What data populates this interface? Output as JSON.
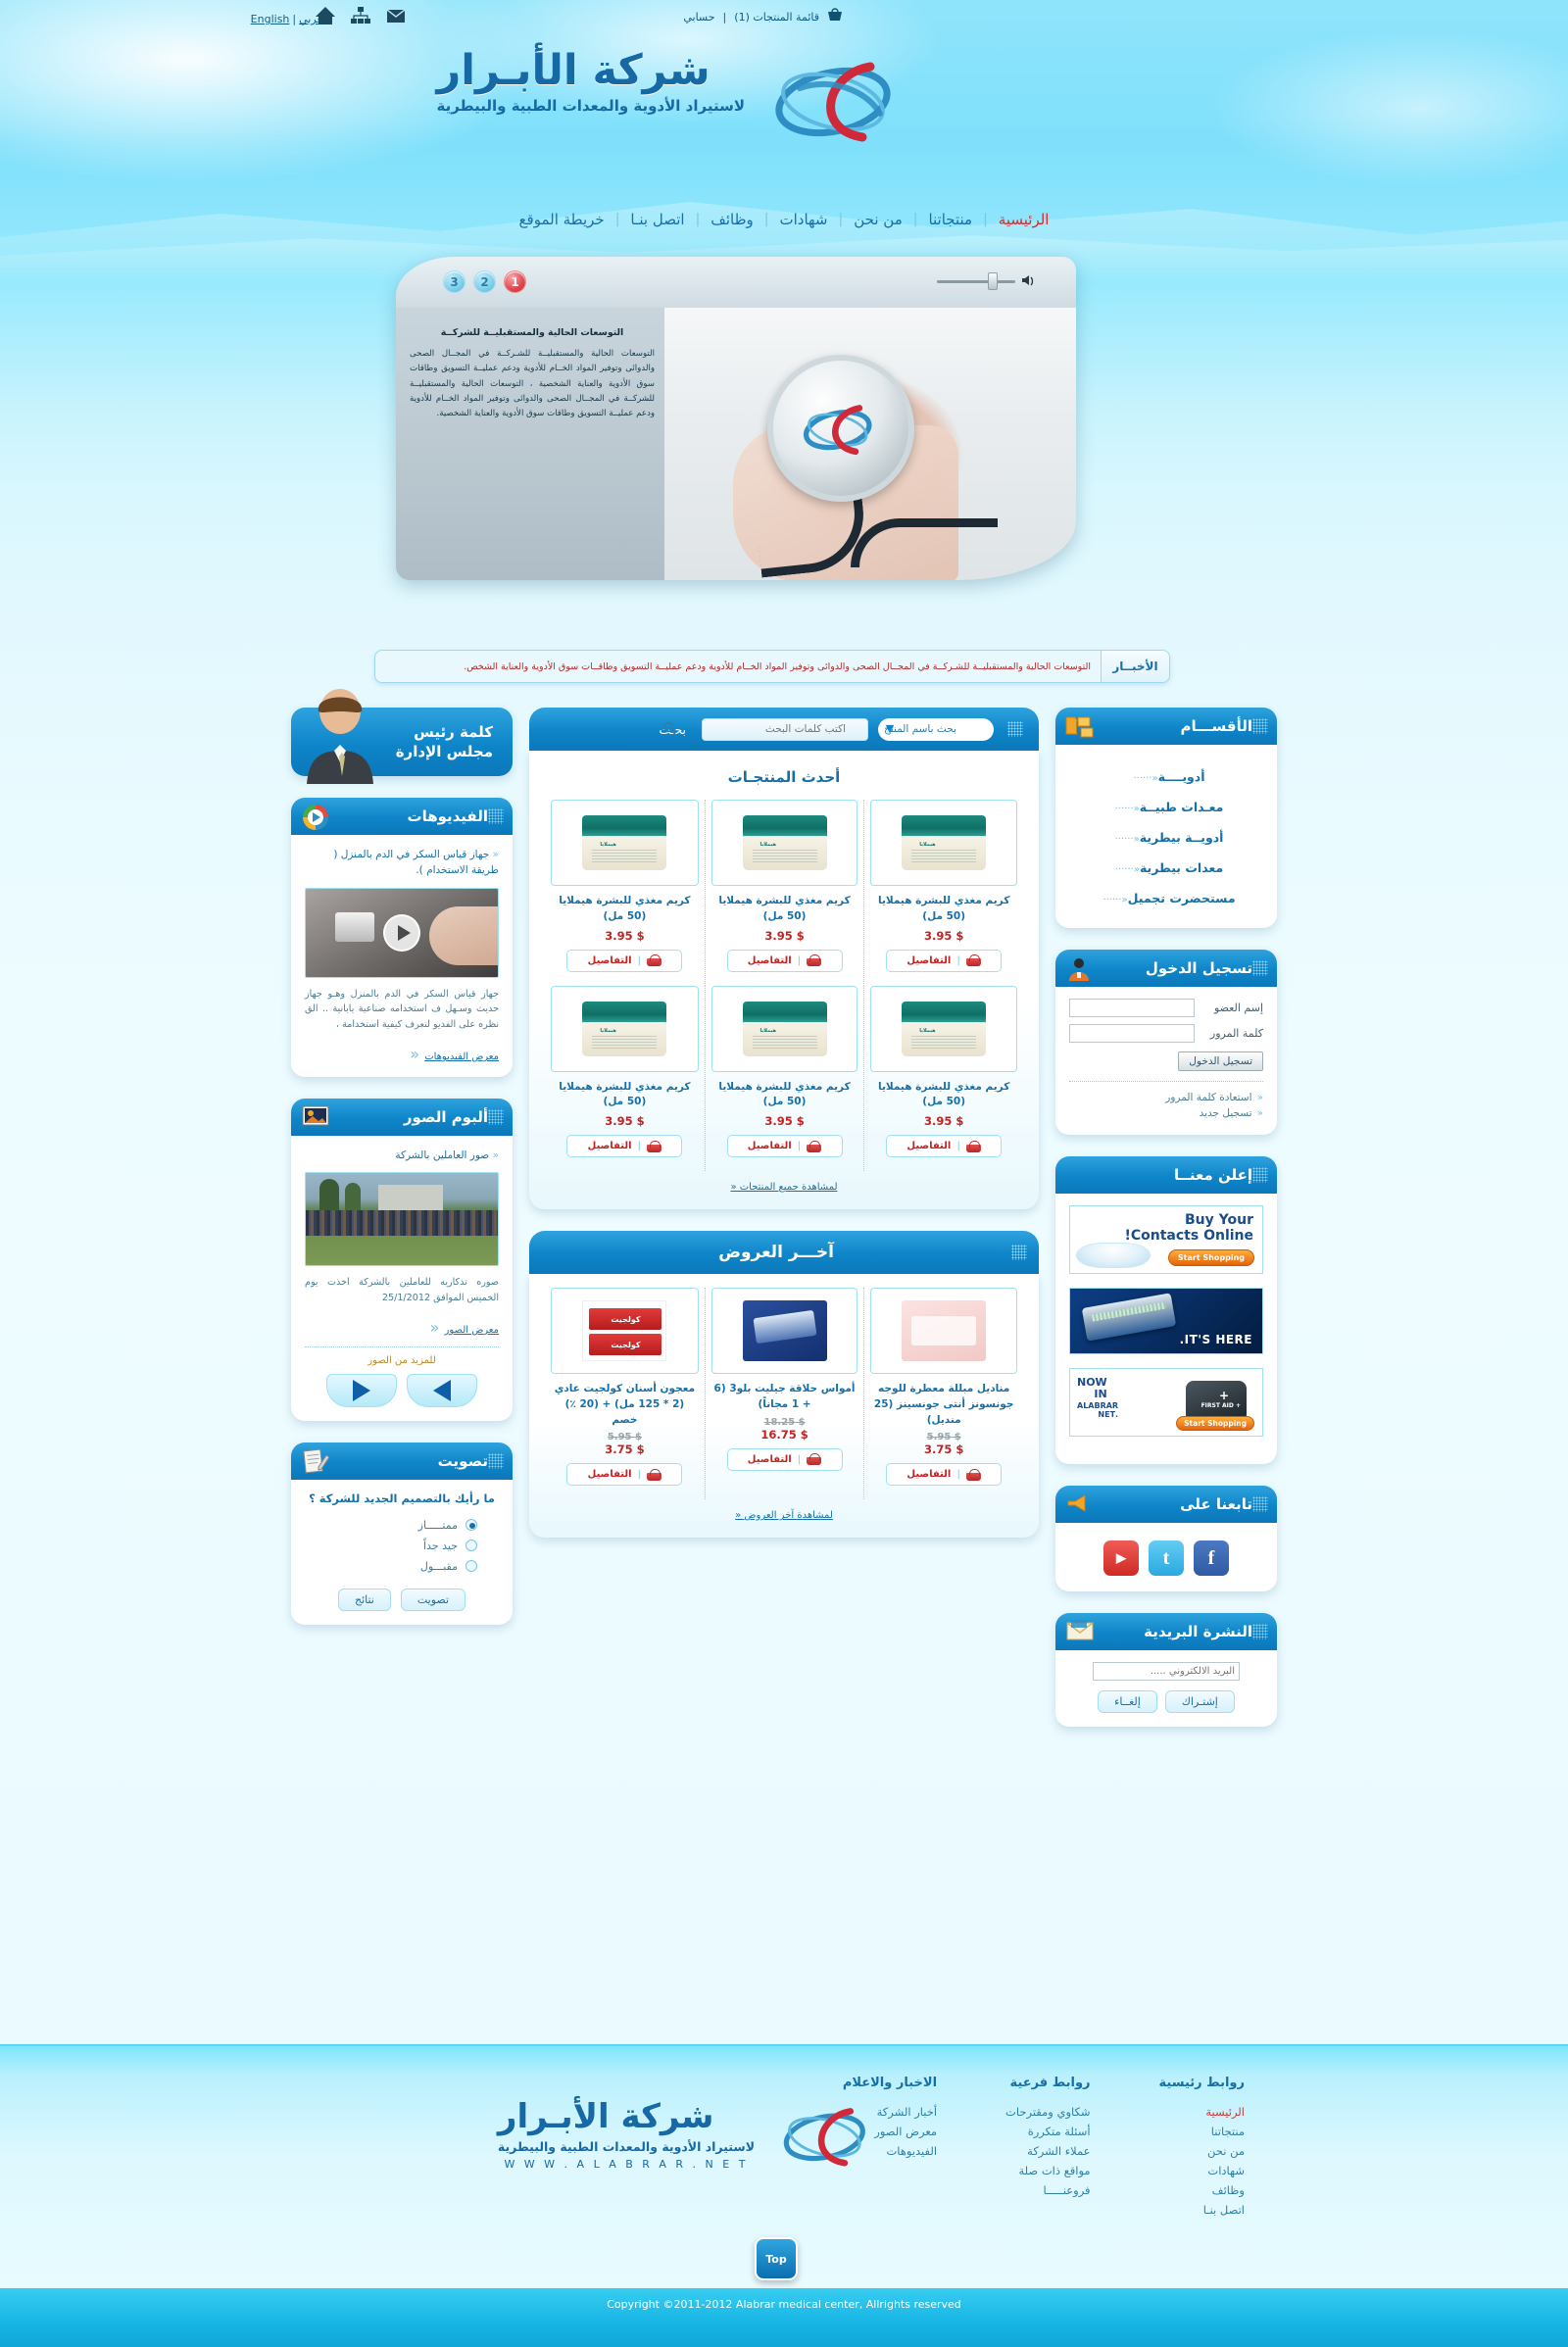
{
  "topbar": {
    "lang_ar": "عربي",
    "lang_sep": "|",
    "lang_en": "English",
    "cart_label": "قائمة المنتجات (1)",
    "sep": "|",
    "account_label": "حسابي",
    "icons": [
      "cart-icon",
      "mail-icon",
      "sitemap-icon",
      "home-icon"
    ]
  },
  "header": {
    "brand_title": "شركة الأبـرار",
    "brand_sub": "لاستيراد الأدوية والمعدات الطبية والبيطرية"
  },
  "nav": {
    "items": [
      {
        "label": "الرئيسية",
        "active": true
      },
      {
        "label": "منتجاتنا",
        "active": false
      },
      {
        "label": "من نحن",
        "active": false
      },
      {
        "label": "شهادات",
        "active": false
      },
      {
        "label": "وظائف",
        "active": false
      },
      {
        "label": "اتصل بنـا",
        "active": false
      },
      {
        "label": "خريطة الموقع",
        "active": false
      }
    ]
  },
  "slider": {
    "bullets": [
      "1",
      "2",
      "3"
    ],
    "active_bullet": "1",
    "slide_title": "التوسعات الحالية والمستقبليــة للشركــة",
    "slide_text": "التوسعات الحالية والمستقبليــة للشـركــة في المجــال الصحى والدوائى وتوفير المواد الخــام للأدوية ودعم عمليــة التسويق وطاقات سوق الأدوية والعناية الشخصية ، التوسعات الحالية والمستقبليــة للشركــة في المجــال الصحى والدوائى وتوفير المواد الخــام للأدوية ودعم عمليــة التسويق وطاقات سوق الأدوية والعناية الشخصية."
  },
  "news": {
    "label": "الأخبــار",
    "text": "التوسعات الحالية والمستقبليــة للشـركــة في المجــال الصحى والدوائى وتوفير المواد الخــام للأدوية ودعم عمليــة التسويق وطاقــات سوق الأدوية والعناية الشخص."
  },
  "sidebar_right": {
    "categories": {
      "title": "الأقســـام",
      "icon": "folders-icon",
      "items": [
        "أدويــــة",
        "معـدات طبيــة",
        "أدويــة بيطرية",
        "معدات بيطرية",
        "مستحضرت تجميل"
      ],
      "chev": "«······"
    },
    "login": {
      "title": "تسجيل الدخول",
      "icon": "user-icon",
      "username_label": "إسم العضو",
      "username_value": "",
      "password_label": "كلمة المرور",
      "password_value": "",
      "submit_label": "تسجيل الدخول",
      "links": [
        "استعادة كلمة المرور",
        "تسجيل جديد"
      ]
    },
    "ads": {
      "title": "إعلن معنــا",
      "ad1_line1": "Buy Your",
      "ad1_line2": "Contacts Online!",
      "ad1_button": "Start Shopping",
      "ad2_text": "IT'S HERE.",
      "ad3_now": "NOW",
      "ad3_in": "IN",
      "ad3_brand": "ALABRAR",
      "ad3_net": ".NET",
      "ad3_kit": "+ FIRST AID",
      "ad3_button": "Start Shopping"
    },
    "follow": {
      "title": "تابعنا على",
      "icon": "megaphone-icon",
      "networks": [
        "facebook-icon",
        "twitter-icon",
        "youtube-icon"
      ],
      "fb_glyph": "f",
      "tw_glyph": "t",
      "yt_glyph": "▶"
    },
    "newsletter": {
      "title": "النشرة البريدية",
      "icon": "envelope-icon",
      "email_label": "البريد الالكتروني",
      "email_placeholder": "البريد الالكتروني ..... ",
      "subscribe_label": "إشتـراك",
      "unsubscribe_label": "إلغــاء"
    }
  },
  "sidebar_left": {
    "chairman": {
      "line1": "كلمة رئيس",
      "line2": "مجلس الإدارة",
      "icon": "chairman-avatar"
    },
    "videos": {
      "title": "الفيديوهات",
      "icon": "media-player-icon",
      "item_title": "جهاز قياس السكر في الدم بالمنزل ( طريقة الاستخدام ).",
      "chev": "«",
      "description": "جهاز قياس السكر في الدم بالمنزل وهـو جهاز حديث وسـهل ف استخدامه صناعية يابانية .. الق نظره على الفديو لتعرف كيفية استخدامة ،",
      "more_label": "معرض الفيديوهات",
      "play_icon": "play-icon"
    },
    "album": {
      "title": "ألبوم الصور",
      "icon": "photo-icon",
      "item_title": "صور العاملين بالشركة",
      "chev": "«",
      "caption": "صوره تذكاريه للعاملين بالشركة  اخذت يوم الخميس الموافق 25/1/2012",
      "more_label": "معرض الصور",
      "more_pics_label": "للمزيد من الصور",
      "prev_icon": "arrow-left-icon",
      "next_icon": "arrow-right-icon"
    },
    "poll": {
      "title": "تصويت",
      "icon": "notepad-icon",
      "question": "ما رأيك بالتصميم الجديد للشركة ؟",
      "options": [
        {
          "label": "ممتـــــاز",
          "selected": true
        },
        {
          "label": "جيد جداً",
          "selected": false
        },
        {
          "label": "مقبـــول",
          "selected": false
        }
      ],
      "vote_label": "تصويت",
      "results_label": "نتائج"
    }
  },
  "main": {
    "search": {
      "dots_icon": "dots-icon",
      "select_value": "بحث باسم المنتج",
      "select_icon": "chevron-down-icon",
      "input_placeholder": "اكتب كلمات البحث",
      "input_value": "",
      "magnifier_icon": "search-icon",
      "button_label": "بحـث"
    },
    "latest_products": {
      "title": "أحدث المنتجـات",
      "all_link": "لمشاهدة جميع المنتجات «",
      "details_label": "التفاصيل",
      "cart_icon": "cart-icon",
      "separator": "|",
      "items": [
        {
          "name": "كريم مغذي للبشرة هيملايا (50 مل)",
          "price": "$ 3.95",
          "old_price": "",
          "image": "cream-jar"
        },
        {
          "name": "كريم مغذي للبشرة هيملايا (50 مل)",
          "price": "$ 3.95",
          "old_price": "",
          "image": "cream-jar"
        },
        {
          "name": "كريم مغذي للبشرة هيملايا (50 مل)",
          "price": "$ 3.95",
          "old_price": "",
          "image": "cream-jar"
        },
        {
          "name": "كريم مغذي للبشرة هيملايا (50 مل)",
          "price": "$ 3.95",
          "old_price": "",
          "image": "cream-jar"
        },
        {
          "name": "كريم مغذي للبشرة هيملايا (50 مل)",
          "price": "$ 3.95",
          "old_price": "",
          "image": "cream-jar"
        },
        {
          "name": "كريم مغذي للبشرة هيملايا (50 مل)",
          "price": "$ 3.95",
          "old_price": "",
          "image": "cream-jar"
        }
      ]
    },
    "offers": {
      "title": "آخـــر العروض",
      "all_link": "لمشاهدة آخر العروض «",
      "details_label": "التفاصيل",
      "cart_icon": "cart-icon",
      "separator": "|",
      "items": [
        {
          "name": "مناديل مبللة معطرة للوجه جونسونز أنتى جونسينز (25 منديل)",
          "price": "$ 3.75",
          "old_price": "$ 5.95",
          "image": "wipes-pack"
        },
        {
          "name": "أمواس حلاقة جيليت بلو3 (6 + 1 مجاناً)",
          "price": "$ 16.75",
          "old_price": "$ 18.25",
          "image": "razor-pack"
        },
        {
          "name": "معجون أسنان كولجيت عادي (2 * 125 مل) + (20 ٪) خصم",
          "price": "$ 3.75",
          "old_price": "$ 5.95",
          "image": "toothpaste-pack"
        }
      ]
    }
  },
  "footer": {
    "columns": [
      {
        "title": "روابط رئيسية",
        "links": [
          {
            "label": "الرئيسية",
            "active": true
          },
          {
            "label": "منتجاتنا",
            "active": false
          },
          {
            "label": "من نحن",
            "active": false
          },
          {
            "label": "شهادات",
            "active": false
          },
          {
            "label": "وظائف",
            "active": false
          },
          {
            "label": "اتصل بنـا",
            "active": false
          }
        ]
      },
      {
        "title": "روابط فرعية",
        "links": [
          {
            "label": "شكاوي ومقترحات",
            "active": false
          },
          {
            "label": "أسئلة متكررة",
            "active": false
          },
          {
            "label": "عملاء الشركة",
            "active": false
          },
          {
            "label": "مواقع ذات صلة",
            "active": false
          },
          {
            "label": "فروعنـــــا",
            "active": false
          }
        ]
      },
      {
        "title": "الاخبار والاعلام",
        "links": [
          {
            "label": "أخبار الشركة",
            "active": false
          },
          {
            "label": "معرض الصور",
            "active": false
          },
          {
            "label": "الفيديوهات",
            "active": false
          }
        ]
      }
    ],
    "brand_title": "شركة الأبـرار",
    "brand_sub": "لاستيراد الأدوية والمعدات الطبية والبيطرية",
    "brand_url": "W W W . A L A B R A R . N E T",
    "top_button": "Top",
    "copyright": "Copyright ©2011-2012 Alabrar medical center, Allrights reserved"
  },
  "colors": {
    "brand_blue": "#1669a5",
    "panel_header": "#0e85c9",
    "accent_red": "#c32222",
    "sky": "#8fe4fb"
  }
}
